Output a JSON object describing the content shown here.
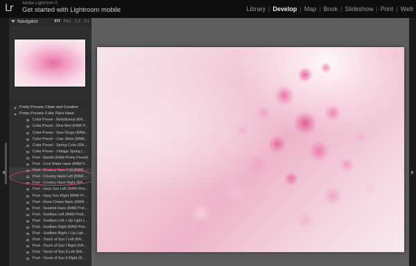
{
  "app": {
    "logo": "Lr",
    "name": "Adobe Lightroom 5",
    "identity": "Get started with Lightroom mobile"
  },
  "modules": [
    {
      "label": "Library",
      "active": false
    },
    {
      "label": "Develop",
      "active": true
    },
    {
      "label": "Map",
      "active": false
    },
    {
      "label": "Book",
      "active": false
    },
    {
      "label": "Slideshow",
      "active": false
    },
    {
      "label": "Print",
      "active": false
    },
    {
      "label": "Web",
      "active": false
    }
  ],
  "navigator": {
    "title": "Navigator",
    "zoom_options": [
      "FIT",
      "FILL",
      "1:1",
      "3:1"
    ],
    "zoom_selected": "FIT"
  },
  "presets": {
    "folders": [
      {
        "label": "Pretty Presets Clean and Creative",
        "open": false
      },
      {
        "label": "Pretty Presets Color Flare Haze",
        "open": true
      }
    ],
    "items": [
      "Color Preset - Berrylicious (RA...",
      "Color Preset - Blue Bird (RAW P...",
      "Color Preset - Dew Drops (RAW...",
      "Color Preset - Lilac Skies (RAW...",
      "Color Preset - Spring Color (RA...",
      "Color Preset - Vintage Spring (...",
      "Post - Backlit (RAW Pretty Preset)",
      "Post - Cool Water Haze (RAW P...",
      "Post - Creamy Haze Full (RAW ...",
      "Post - Creamy Haze Left (RAW ...",
      "Post - Creamy Haze Right (RA...",
      "Post - Hazy Sun Left (RAW Pret...",
      "Post - Hazy Sun Right (RAW Pr...",
      "Post - Rose Cream Haze (RAW ...",
      "Post - Seamist Haze (RAW Pret...",
      "Post - Sunflare Left (RAW Prett...",
      "Post - Sunflare Left + Up Light (...",
      "Post - Sunflare Right (RAW Pret...",
      "Post - Sunflare Right + Up Ligh...",
      "Post - Touch of Sun I Left (RA...",
      "Post - Touch of Sun I Right (RA...",
      "Post - Touch of Sun II Left (RA...",
      "Post - Touch of Sun II Right (R..."
    ],
    "highlighted": [
      "Post - Creamy Haze Full (RAW ...",
      "Post - Creamy Haze Left (RAW ..."
    ]
  },
  "colors": {
    "highlight_ellipse": "#d0457f",
    "panel_bg": "#2e2e2e",
    "canvas_bg": "#5e5e5e",
    "topbar_bg": "#0e0e0e"
  }
}
